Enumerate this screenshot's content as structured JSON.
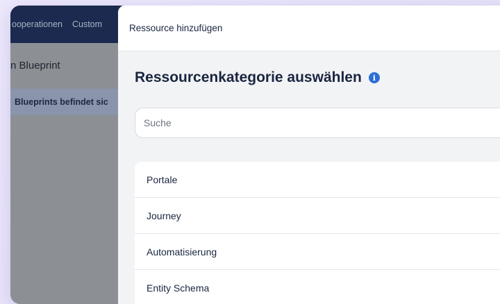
{
  "background_app": {
    "nav_items": [
      "ooperationen",
      "Custom"
    ],
    "heading": "n Blueprint",
    "banner_text": "Blueprints befindet sic"
  },
  "modal": {
    "header_title": "Ressource hinzufügen",
    "section_title": "Ressourcenkategorie auswählen",
    "info_icon": "info-icon",
    "search": {
      "placeholder": "Suche",
      "value": ""
    },
    "categories": [
      {
        "label": "Portale"
      },
      {
        "label": "Journey"
      },
      {
        "label": "Automatisierung"
      },
      {
        "label": "Entity Schema"
      }
    ]
  },
  "colors": {
    "navy": "#1b2a4e",
    "modal_bg": "#f2f3f5",
    "info_blue": "#2b6fd6",
    "text": "#1a2540"
  }
}
